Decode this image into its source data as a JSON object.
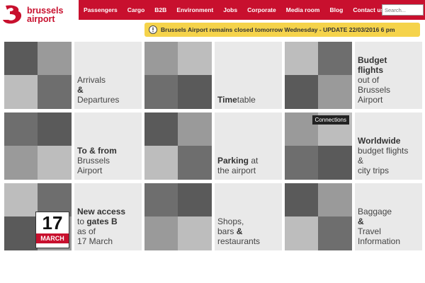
{
  "brand": {
    "line1": "brussels",
    "line2": "airport",
    "color": "#c8102e"
  },
  "nav": [
    "Passengers",
    "Cargo",
    "B2B",
    "Environment",
    "Jobs",
    "Corporate",
    "Media room",
    "Blog",
    "Contact us"
  ],
  "search": {
    "placeholder": "Search..."
  },
  "alert": {
    "text": "Brussels Airport remains closed tomorrow Wednesday - UPDATE 22/03/2016 6 pm",
    "icon": "warning-icon",
    "color": "#f5d34b"
  },
  "tiles": [
    {
      "photo": "landing-gear-photo",
      "lines": [
        {
          "text": "Arrivals"
        },
        {
          "text": "&",
          "bold": true
        },
        {
          "text": "Departures"
        }
      ]
    },
    {
      "photo": "departure-board-photo",
      "lines": [
        {
          "parts": [
            {
              "text": "Time",
              "bold": true
            },
            {
              "text": "table"
            }
          ]
        }
      ]
    },
    {
      "photo": "brucargo-sign-photo",
      "lines": [
        {
          "text": "Budget",
          "bold": true
        },
        {
          "text": "flights",
          "bold": true
        },
        {
          "text": "out of"
        },
        {
          "text": "Brussels"
        },
        {
          "text": "Airport"
        }
      ]
    },
    {
      "photo": "train-platform-photo",
      "lines": [
        {
          "text": "To & from",
          "bold": true
        },
        {
          "text": "Brussels"
        },
        {
          "text": "Airport"
        }
      ]
    },
    {
      "photo": "parking-ticket-photo",
      "lines": [
        {
          "parts": [
            {
              "text": "Parking",
              "bold": true
            },
            {
              "text": " at"
            }
          ]
        },
        {
          "text": "the airport"
        }
      ]
    },
    {
      "photo": "connections-plane-photo",
      "badge": "Connections",
      "lines": [
        {
          "text": "Worldwide",
          "bold": true
        },
        {
          "text": "budget flights"
        },
        {
          "text": "&"
        },
        {
          "text": "city trips"
        }
      ]
    },
    {
      "photo": "gates-calendar-photo",
      "calendar": {
        "day": "17",
        "month": "MARCH"
      },
      "lines": [
        {
          "text": "New access",
          "bold": true
        },
        {
          "parts": [
            {
              "text": "to "
            },
            {
              "text": "gates B",
              "bold": true
            }
          ]
        },
        {
          "text": "as of"
        },
        {
          "text": "17 March"
        }
      ]
    },
    {
      "photo": "restaurant-photo",
      "lines": [
        {
          "text": "Shops,"
        },
        {
          "parts": [
            {
              "text": "bars "
            },
            {
              "text": "&",
              "bold": true
            }
          ]
        },
        {
          "text": "restaurants"
        }
      ]
    },
    {
      "photo": "baggage-travellers-photo",
      "lines": [
        {
          "text": "Baggage"
        },
        {
          "text": "&",
          "bold": true
        },
        {
          "text": "Travel"
        },
        {
          "text": "Information"
        }
      ]
    }
  ]
}
